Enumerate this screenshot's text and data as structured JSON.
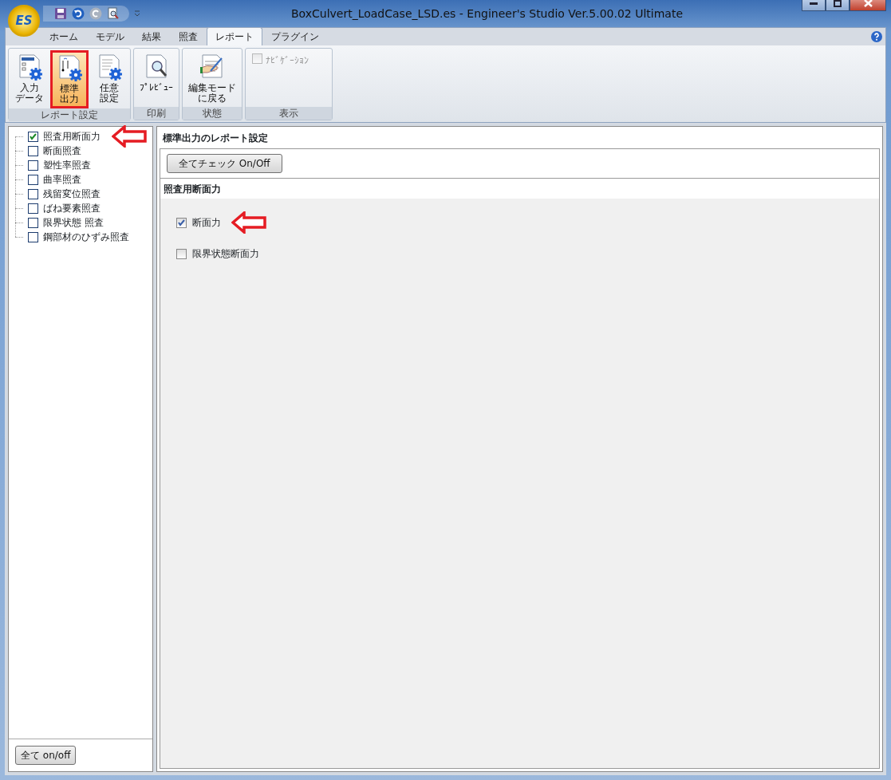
{
  "window": {
    "title": "BoxCulvert_LoadCase_LSD.es - Engineer's Studio Ver.5.00.02 Ultimate"
  },
  "app_button": {
    "label": "ES"
  },
  "ribbon": {
    "tabs": [
      {
        "label": "ホーム",
        "selected": false
      },
      {
        "label": "モデル",
        "selected": false
      },
      {
        "label": "結果",
        "selected": false
      },
      {
        "label": "照査",
        "selected": false
      },
      {
        "label": "レポート",
        "selected": true
      },
      {
        "label": "プラグイン",
        "selected": false
      }
    ],
    "groups": [
      {
        "label": "レポート設定",
        "items": [
          {
            "kind": "button",
            "lines": [
              "入力",
              "データ"
            ],
            "highlighted": false
          },
          {
            "kind": "button",
            "lines": [
              "標準",
              "出力"
            ],
            "highlighted": true
          },
          {
            "kind": "button",
            "lines": [
              "任意",
              "設定"
            ],
            "highlighted": false
          }
        ]
      },
      {
        "label": "印刷",
        "items": [
          {
            "kind": "button",
            "lines": [
              "ﾌﾟﾚﾋﾞｭｰ"
            ],
            "highlighted": false
          }
        ]
      },
      {
        "label": "状態",
        "items": [
          {
            "kind": "button",
            "lines": [
              "編集モード",
              "に戻る"
            ],
            "highlighted": false
          }
        ]
      },
      {
        "label": "表示",
        "items": [
          {
            "kind": "checkbox",
            "label": "ﾅﾋﾞｹﾞｰｼｮﾝ",
            "checked": false,
            "disabled": true
          }
        ]
      }
    ]
  },
  "tree": {
    "items": [
      {
        "label": "照査用断面力",
        "checked": true,
        "arrow": true
      },
      {
        "label": "断面照査",
        "checked": false,
        "arrow": false
      },
      {
        "label": "塑性率照査",
        "checked": false,
        "arrow": false
      },
      {
        "label": "曲率照査",
        "checked": false,
        "arrow": false
      },
      {
        "label": "残留変位照査",
        "checked": false,
        "arrow": false
      },
      {
        "label": "ばね要素照査",
        "checked": false,
        "arrow": false
      },
      {
        "label": "限界状態 照査",
        "checked": false,
        "arrow": false
      },
      {
        "label": "鋼部材のひずみ照査",
        "checked": false,
        "arrow": false
      }
    ],
    "button": "全て on/off"
  },
  "panel": {
    "title": "標準出力のレポート設定",
    "check_all_button": "全てチェック On/Off",
    "section_title": "照査用断面力",
    "options": [
      {
        "label": "断面力",
        "checked": true,
        "arrow": true
      },
      {
        "label": "限界状態断面力",
        "checked": false,
        "arrow": false
      }
    ]
  }
}
